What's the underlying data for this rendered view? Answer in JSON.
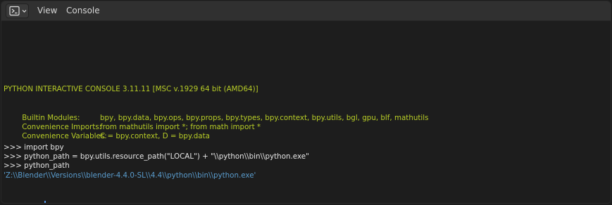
{
  "header": {
    "editor_type_icon": "console-editor-icon",
    "menu": {
      "view_label": "View",
      "console_label": "Console"
    }
  },
  "console": {
    "banner": "PYTHON INTERACTIVE CONSOLE 3.11.11 [MSC v.1929 64 bit (AMD64)]",
    "builtin_modules_label": "Builtin Modules:",
    "builtin_modules_value": "bpy, bpy.data, bpy.ops, bpy.props, bpy.types, bpy.context, bpy.utils, bgl, gpu, blf, mathutils",
    "convenience_imports_label": "Convenience Imports:",
    "convenience_imports_value": "from mathutils import *; from math import *",
    "convenience_variables_label": "Convenience Variables:",
    "convenience_variables_value": "C = bpy.context, D = bpy.data",
    "history": [
      ">>> import bpy",
      ">>> python_path = bpy.utils.resource_path(\"LOCAL\") + \"\\\\python\\\\bin\\\\python.exe\"",
      ">>> python_path"
    ],
    "output": "'Z:\\\\Blender\\\\Versions\\\\blender-4.4.0-SL\\\\4.4\\\\python\\\\bin\\\\python.exe'",
    "prompt": ">>> ",
    "current_input": "",
    "colors": {
      "info": "#b7cc27",
      "input": "#e6e6e6",
      "output": "#5a9ccd",
      "cursor": "#5294e2",
      "background": "#1d1d1d",
      "header": "#303030"
    }
  }
}
